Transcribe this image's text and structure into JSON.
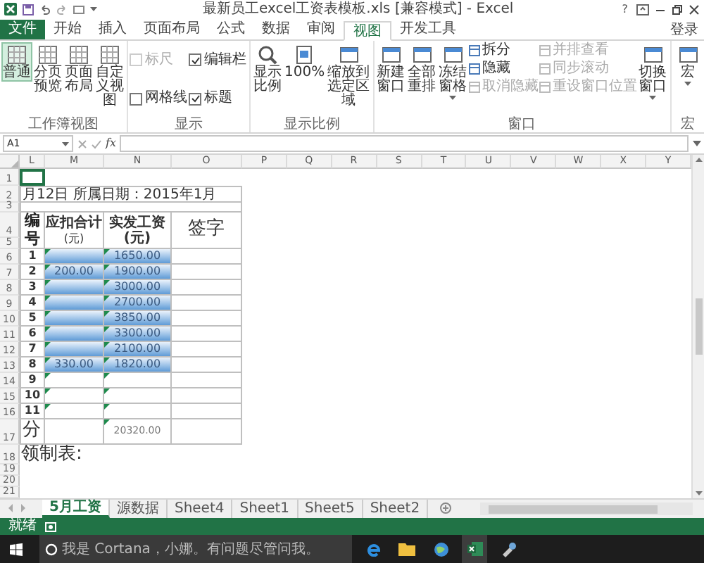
{
  "window": {
    "title": "最新员工excel工资表模板.xls [兼容模式] - Excel",
    "help": "?"
  },
  "ribbon_tabs": [
    {
      "label": "文件",
      "kind": "file",
      "selected": false
    },
    {
      "label": "开始",
      "kind": "tab",
      "selected": false
    },
    {
      "label": "插入",
      "kind": "tab",
      "selected": false
    },
    {
      "label": "页面布局",
      "kind": "tab",
      "selected": false
    },
    {
      "label": "公式",
      "kind": "tab",
      "selected": false
    },
    {
      "label": "数据",
      "kind": "tab",
      "selected": false
    },
    {
      "label": "审阅",
      "kind": "tab",
      "selected": false
    },
    {
      "label": "视图",
      "kind": "tab",
      "selected": true
    },
    {
      "label": "开发工具",
      "kind": "tab",
      "selected": false
    }
  ],
  "account": {
    "label": "登录"
  },
  "ribbon_groups": [
    {
      "label": "工作簿视图",
      "columns": [
        [
          {
            "kind": "large",
            "label": "普通",
            "selected": true
          }
        ],
        [
          {
            "kind": "large",
            "label": "分页预览",
            "selected": false
          }
        ],
        [
          {
            "kind": "large",
            "label": "页面布局",
            "selected": false
          }
        ],
        [
          {
            "kind": "large",
            "label": "自定义视图",
            "selected": false
          }
        ]
      ]
    },
    {
      "label": "显示",
      "columns": [
        [
          {
            "kind": "check",
            "label": "标尺",
            "checked": false,
            "disabled": true
          },
          {
            "kind": "check",
            "label": "网格线",
            "checked": false,
            "disabled": false
          }
        ],
        [
          {
            "kind": "check",
            "label": "编辑栏",
            "checked": true,
            "disabled": false
          },
          {
            "kind": "check",
            "label": "标题",
            "checked": true,
            "disabled": false
          }
        ]
      ]
    },
    {
      "label": "显示比例",
      "columns": [
        [
          {
            "kind": "large",
            "label": "显示比例"
          }
        ],
        [
          {
            "kind": "large",
            "label": "100%"
          }
        ],
        [
          {
            "kind": "large",
            "label": "缩放到选定区域"
          }
        ]
      ]
    },
    {
      "label": "窗口",
      "columns": [
        [
          {
            "kind": "large",
            "label": "新建窗口"
          }
        ],
        [
          {
            "kind": "large",
            "label": "全部重排"
          }
        ],
        [
          {
            "kind": "large",
            "label": "冻结窗格",
            "menu": true
          }
        ],
        [
          {
            "kind": "small",
            "label": "拆分",
            "disabled": false
          },
          {
            "kind": "small",
            "label": "隐藏",
            "disabled": false
          },
          {
            "kind": "small",
            "label": "取消隐藏",
            "disabled": true
          }
        ],
        [
          {
            "kind": "small",
            "label": "并排查看",
            "disabled": true
          },
          {
            "kind": "small",
            "label": "同步滚动",
            "disabled": true
          },
          {
            "kind": "small",
            "label": "重设窗口位置",
            "disabled": true
          }
        ],
        [
          {
            "kind": "large",
            "label": "切换窗口",
            "menu": true
          }
        ]
      ]
    },
    {
      "label": "宏",
      "columns": [
        [
          {
            "kind": "large",
            "label": "宏",
            "menu": true
          }
        ]
      ]
    }
  ],
  "formula_bar": {
    "name_box": "A1",
    "function_label": "fx"
  },
  "sheet": {
    "columns": [
      "L",
      "M",
      "N",
      "O",
      "P",
      "Q",
      "R",
      "S",
      "T",
      "U",
      "V",
      "W",
      "X",
      "Y"
    ],
    "row_numbers": [
      "1",
      "2",
      "3",
      "4",
      "5",
      "6",
      "7",
      "8",
      "9",
      "10",
      "11",
      "12",
      "13",
      "14",
      "15",
      "16",
      "17",
      "18",
      "19",
      "20",
      "21"
    ],
    "date_line": "月12日 所属日期：2015年1月",
    "headers": {
      "number": "编号",
      "deduct": "应扣合计",
      "deduct_unit": "(元)",
      "net": "实发工资(元)",
      "sign": "签字"
    },
    "rows": [
      {
        "no": "1",
        "net": "1650.00",
        "highlighted": true,
        "flagged": true
      },
      {
        "no": "2",
        "deduct": "200.00",
        "net": "1900.00",
        "highlighted": true,
        "flagged": true
      },
      {
        "no": "3",
        "net": "3000.00",
        "highlighted": true,
        "flagged": true
      },
      {
        "no": "4",
        "net": "2700.00",
        "highlighted": true,
        "flagged": true
      },
      {
        "no": "5",
        "net": "3850.00",
        "highlighted": true,
        "flagged": true
      },
      {
        "no": "6",
        "net": "3300.00",
        "highlighted": true,
        "flagged": true
      },
      {
        "no": "7",
        "net": "2100.00",
        "highlighted": true,
        "flagged": true
      },
      {
        "no": "8",
        "deduct": "330.00",
        "net": "1820.00",
        "highlighted": true,
        "flagged": true
      },
      {
        "no": "9",
        "highlighted": false,
        "flagged": true
      },
      {
        "no": "10",
        "highlighted": false,
        "flagged": true
      },
      {
        "no": "11",
        "highlighted": false,
        "flagged": true
      }
    ],
    "total": {
      "label": "分",
      "net": "20320.00",
      "flagged": true
    },
    "footer": "领制表:"
  },
  "sheet_tabs": [
    {
      "label": "5月工资",
      "selected": true
    },
    {
      "label": "源数据",
      "selected": false
    },
    {
      "label": "Sheet4",
      "selected": false
    },
    {
      "label": "Sheet1",
      "selected": false
    },
    {
      "label": "Sheet5",
      "selected": false
    },
    {
      "label": "Sheet2",
      "selected": false
    }
  ],
  "status_bar": {
    "text": "就绪"
  },
  "taskbar": {
    "search_placeholder": "我是 Cortana，小娜。有问题尽管问我。"
  }
}
